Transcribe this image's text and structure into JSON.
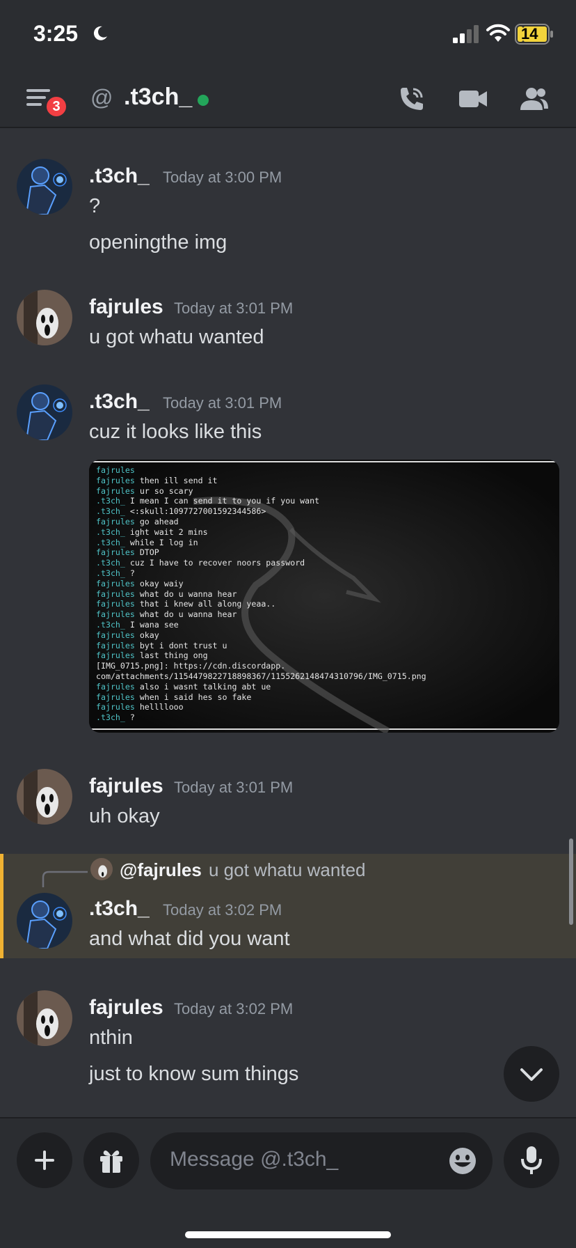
{
  "status_bar": {
    "time": "3:25",
    "battery": "14"
  },
  "header": {
    "badge_count": "3",
    "at_symbol": "@",
    "channel_name": ".t3ch_"
  },
  "messages": [
    {
      "author": ".t3ch_",
      "timestamp": "Today at 3:00 PM",
      "lines": [
        "?",
        "openingthe img"
      ]
    },
    {
      "author": "fajrules",
      "timestamp": "Today at 3:01 PM",
      "lines": [
        "u got whatu wanted"
      ]
    },
    {
      "author": ".t3ch_",
      "timestamp": "Today at 3:01 PM",
      "lines": [
        "cuz it looks like this"
      ]
    },
    {
      "author": "fajrules",
      "timestamp": "Today at 3:01 PM",
      "lines": [
        "uh okay"
      ]
    },
    {
      "author": ".t3ch_",
      "timestamp": "Today at 3:02 PM",
      "lines": [
        "and what did you want"
      ],
      "reply": {
        "mention": "@fajrules",
        "text": "u got whatu wanted"
      }
    },
    {
      "author": "fajrules",
      "timestamp": "Today at 3:02 PM",
      "lines": [
        "nthin",
        "just to know sum things"
      ]
    }
  ],
  "attachment_terminal": [
    {
      "user": "fajrules",
      "text": ""
    },
    {
      "user": "fajrules",
      "text": "then ill send it"
    },
    {
      "user": "fajrules",
      "text": "ur so scary"
    },
    {
      "user": ".t3ch_",
      "text": "I mean I can send it to you if you want"
    },
    {
      "user": ".t3ch_",
      "text": "<:skull:1097727001592344586>"
    },
    {
      "user": "fajrules",
      "text": "go ahead"
    },
    {
      "user": ".t3ch_",
      "text": "ight wait 2 mins"
    },
    {
      "user": ".t3ch_",
      "text": "while I log in"
    },
    {
      "user": "fajrules",
      "text": "DTOP"
    },
    {
      "user": ".t3ch_",
      "text": "cuz I have to recover noors password"
    },
    {
      "user": ".t3ch_",
      "text": "?"
    },
    {
      "user": "fajrules",
      "text": "okay waiy"
    },
    {
      "user": "fajrules",
      "text": "what do u wanna hear"
    },
    {
      "user": "fajrules",
      "text": "that i knew all along yeaa.."
    },
    {
      "user": "fajrules",
      "text": "what do u wanna hear"
    },
    {
      "user": ".t3ch_",
      "text": "I wana see"
    },
    {
      "user": "fajrules",
      "text": "okay"
    },
    {
      "user": "fajrules",
      "text": "byt i dont trust u"
    },
    {
      "user": "fajrules",
      "text": "last thing ong"
    },
    {
      "user": "",
      "text": "[IMG_0715.png]: https://cdn.discordapp."
    },
    {
      "user": "",
      "text": "com/attachments/1154479822718898367/1155262148474310796/IMG_0715.png"
    },
    {
      "user": "fajrules",
      "text": "also i wasnt talking abt ue"
    },
    {
      "user": "fajrules",
      "text": "when i said hes so fake"
    },
    {
      "user": "fajrules",
      "text": "hellllooo"
    },
    {
      "user": ".t3ch_",
      "text": "?"
    }
  ],
  "composer": {
    "placeholder": "Message @.t3ch_"
  },
  "colors": {
    "background": "#313338",
    "header": "#2b2d31",
    "online": "#23a55a",
    "badge": "#f23f43",
    "reply_highlight": "#f0b232",
    "terminal_user": "#4fc3c7"
  },
  "icons": [
    "moon-icon",
    "signal-icon",
    "wifi-icon",
    "battery-icon",
    "menu-icon",
    "at-icon",
    "call-icon",
    "video-icon",
    "members-icon",
    "chevron-down-icon",
    "plus-icon",
    "gift-icon",
    "emoji-icon",
    "mic-icon"
  ]
}
